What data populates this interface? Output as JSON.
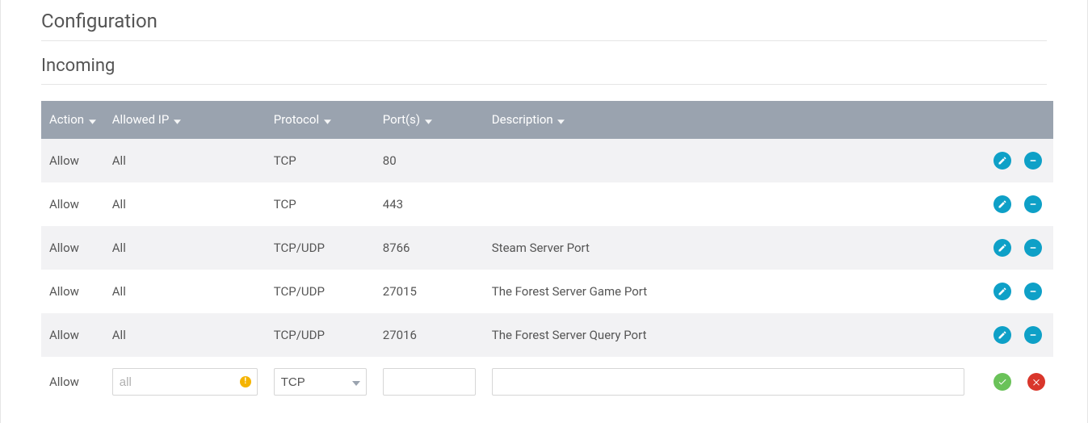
{
  "section_title": "Configuration",
  "sub_title": "Incoming",
  "headers": {
    "action": "Action",
    "allowed_ip": "Allowed IP",
    "protocol": "Protocol",
    "ports": "Port(s)",
    "description": "Description"
  },
  "rows": [
    {
      "action": "Allow",
      "allowed_ip": "All",
      "protocol": "TCP",
      "ports": "80",
      "description": ""
    },
    {
      "action": "Allow",
      "allowed_ip": "All",
      "protocol": "TCP",
      "ports": "443",
      "description": ""
    },
    {
      "action": "Allow",
      "allowed_ip": "All",
      "protocol": "TCP/UDP",
      "ports": "8766",
      "description": "Steam Server Port"
    },
    {
      "action": "Allow",
      "allowed_ip": "All",
      "protocol": "TCP/UDP",
      "ports": "27015",
      "description": "The Forest Server Game Port"
    },
    {
      "action": "Allow",
      "allowed_ip": "All",
      "protocol": "TCP/UDP",
      "ports": "27016",
      "description": "The Forest Server Query Port"
    }
  ],
  "add_rule": {
    "action_label": "Allow",
    "ip_placeholder": "all",
    "ip_value": "",
    "protocol_value": "TCP",
    "ports_value": "",
    "description_value": "",
    "warn_badge": "!"
  },
  "icons": {
    "edit": "pencil-icon",
    "remove": "minus-icon",
    "confirm": "check-icon",
    "cancel": "x-icon",
    "sort": "caret-down-icon",
    "dropdown": "chevron-down-icon",
    "warning": "warning-icon"
  },
  "colors": {
    "header_bg": "#9aa3af",
    "row_alt_bg": "#f2f2f4",
    "icon_blue": "#0ea0c7",
    "icon_green": "#6ac259",
    "icon_red": "#d9362b",
    "warn_yellow": "#f5b400"
  }
}
